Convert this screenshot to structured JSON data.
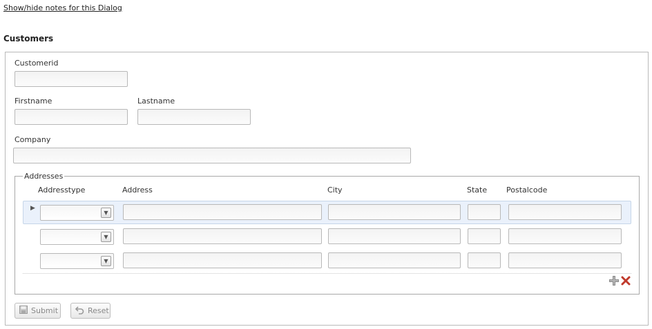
{
  "notes_link": "Show/hide notes for this Dialog",
  "section_title": "Customers",
  "form": {
    "customerid": {
      "label": "Customerid",
      "value": ""
    },
    "firstname": {
      "label": "Firstname",
      "value": ""
    },
    "lastname": {
      "label": "Lastname",
      "value": ""
    },
    "company": {
      "label": "Company",
      "value": ""
    }
  },
  "addresses": {
    "legend": "Addresses",
    "columns": [
      "Addresstype",
      "Address",
      "City",
      "State",
      "Postalcode"
    ],
    "rows": [
      {
        "addresstype": "",
        "address": "",
        "city": "",
        "state": "",
        "postalcode": ""
      },
      {
        "addresstype": "",
        "address": "",
        "city": "",
        "state": "",
        "postalcode": ""
      },
      {
        "addresstype": "",
        "address": "",
        "city": "",
        "state": "",
        "postalcode": ""
      }
    ]
  },
  "icons": {
    "add": "plus-icon",
    "remove": "red-x-icon",
    "submit": "floppy-disk-icon",
    "reset": "undo-arrow-icon",
    "dropdown": "chevron-down-icon",
    "row_marker": "triangle-right-icon"
  },
  "colors": {
    "remove_icon": "#c0392b",
    "selected_row": "#eaf1fb"
  },
  "buttons": {
    "submit": "Submit",
    "reset": "Reset"
  }
}
